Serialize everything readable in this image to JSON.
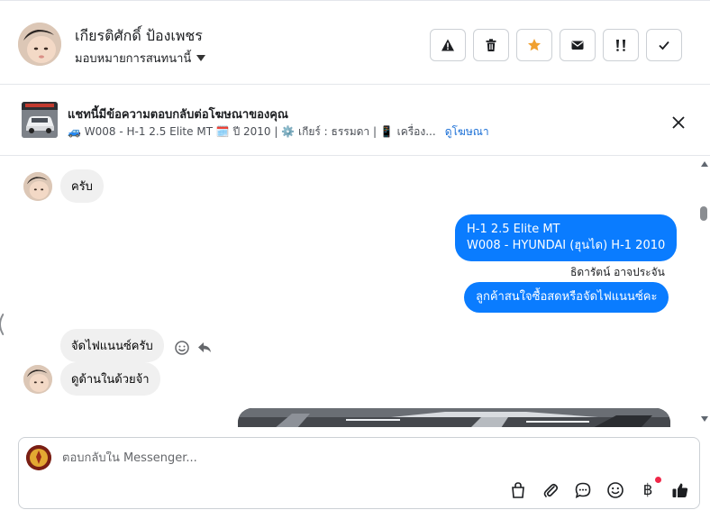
{
  "header": {
    "contact_name": "เกียรติศักดิ์ ป้องเพชร",
    "assign_label": "มอบหมายการสนทนานี้",
    "actions": [
      {
        "name": "report",
        "icon": "warning-icon"
      },
      {
        "name": "delete",
        "icon": "trash-icon"
      },
      {
        "name": "star",
        "icon": "star-icon"
      },
      {
        "name": "mark-unread",
        "icon": "envelope-icon"
      },
      {
        "name": "follow-up",
        "icon": "follow-up-icon"
      },
      {
        "name": "done",
        "icon": "check-icon"
      }
    ]
  },
  "ad_banner": {
    "title": "แชทนี้มีข้อความตอบกลับต่อโฆษณาของคุณ",
    "detail": "🚙 W008 - H-1 2.5 Elite MT 🗓️ ปี 2010 | ⚙️ เกียร์ : ธรรมดา | 📱 เครื่อง...",
    "link": "ดูโฆษณา"
  },
  "messages": [
    {
      "direction": "in",
      "text": "ครับ"
    },
    {
      "direction": "out",
      "line1": "H-1 2.5 Elite MT",
      "line2": "W008 - HYUNDAI (ฮุนได) H-1 2010"
    },
    {
      "direction": "note",
      "text": "ธิดารัตน์ อาจประจัน"
    },
    {
      "direction": "out",
      "text": "ลูกค้าสนใจซื้อสดหรือจัดไฟแนนซ์คะ"
    },
    {
      "direction": "in",
      "text": "จัดไฟแนนซ์ครับ"
    },
    {
      "direction": "in",
      "text": "ดูด้านในด้วยจ้า"
    }
  ],
  "composer": {
    "placeholder": "ตอบกลับใน Messenger...",
    "tools": [
      "shopping-bag-icon",
      "paperclip-icon",
      "saved-reply-icon",
      "emoji-icon",
      "baht-icon",
      "thumbs-up-icon"
    ],
    "baht_symbol": "฿"
  },
  "colors": {
    "accent": "#0a7cff",
    "star": "#f0a030",
    "link": "#1a6fd6",
    "incoming_bubble": "#f0f0f0",
    "notification_dot": "#f02849"
  }
}
